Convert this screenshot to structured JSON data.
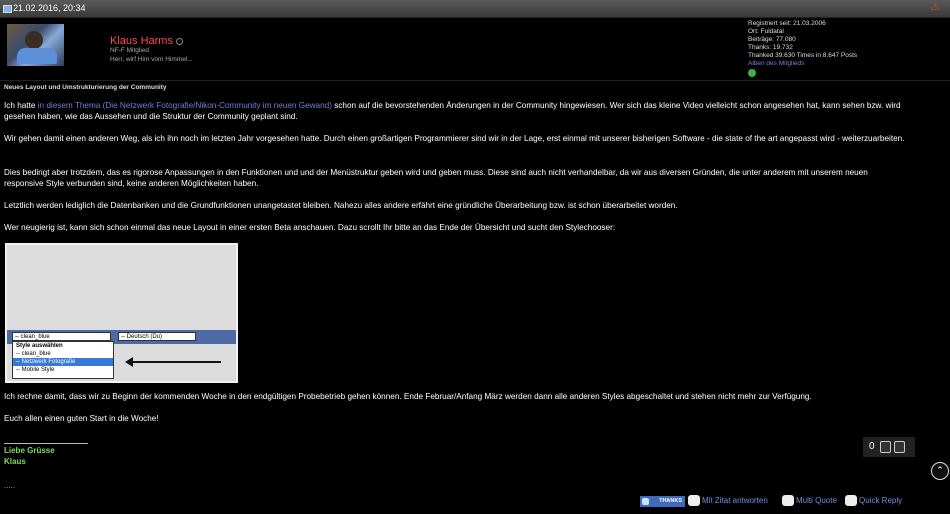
{
  "post": {
    "datetime": "21.02.2016, 20:34",
    "author": {
      "name": "Klaus Harms",
      "rank": "NF-F Mitglied",
      "title": "Herr, wirf Him vom Himmel...",
      "stats": [
        "Registriert seit: 21.03.2006",
        "Ort: Fuldatal",
        "Beiträge: 77.080",
        "Thanks: 19.732",
        "Thanked 39.630 Times in 8.647 Posts"
      ],
      "albums_link": "Alben des Mitglieds"
    },
    "subject": "Neues Layout und Umstrukturierung der Community",
    "paragraphs": {
      "p1_before": "Ich hatte ",
      "p1_link": "in diesem Thema (Die Netzwerk Fotografie/Nikon-Community im neuen Gewand)",
      "p1_after": " schon auf die bevorstehenden Änderungen in der Community hingewiesen. Wer sich das kleine Video vielleicht schon angesehen hat, kann sehen bzw. wird gesehen haben, wie das Aussehen und die Struktur der Community geplant sind.",
      "p2": "Wir gehen damit einen anderen Weg, als ich ihn noch im letzten Jahr vorgesehen hatte. Durch einen großartigen Programmierer sind wir in der Lage, erst einmal mit unserer bisherigen Software - die state of the art angepasst wird - weiterzuarbeiten.",
      "p3": "Dies bedingt aber trotzdem, das es rigorose Anpassungen in den Funktionen und und der Menüstruktur geben wird und geben muss. Diese sind auch nicht verhandelbar, da wir aus diversen Gründen, die unter anderem mit unserem neuen responsive Style verbunden sind, keine anderen Möglichkeiten haben.",
      "p4": "Letztlich werden lediglich die Datenbanken und die Grundfunktionen unangetastet bleiben. Nahezu alles andere erfährt eine gründliche Überarbeitung bzw. ist schon überarbeitet worden.",
      "p5": "Wer neugierig ist, kann sich schon einmal das neue Layout in einer ersten Beta anschauen. Dazu scrollt Ihr bitte an das Ende der Übersicht und sucht den Stylechooser:",
      "p6": "Ich rechne damit, dass wir zu Beginn der kommenden Woche in den endgültigen Probebetrieb gehen können. Ende Februar/Anfang März werden dann alle anderen Styles abgeschaltet und stehen nicht mehr zur Verfügung.",
      "p7": "Euch allen einen guten Start in die Woche!"
    },
    "screenshot": {
      "select_style": "-- clean_blue",
      "select_lang": "-- Deutsch (Du)",
      "dropdown_header": "Style auswählen",
      "options": [
        "-- clean_blue",
        "-- Netzwerk Fotografie",
        "-- Mobile Style"
      ]
    },
    "signature": {
      "line1": "Liebe Grüsse",
      "line2": "Klaus",
      "ellipsis": "....."
    },
    "like_count": "0",
    "actions": {
      "thanks": "THANKS",
      "quote": "Mit Zitat antworten",
      "multi": "Multi Quote",
      "quick": "Quick Reply"
    }
  },
  "colors": {
    "link": "#6f7fd8",
    "username": "#ff4b4b",
    "signature": "#7fdc60",
    "background": "#000000"
  }
}
